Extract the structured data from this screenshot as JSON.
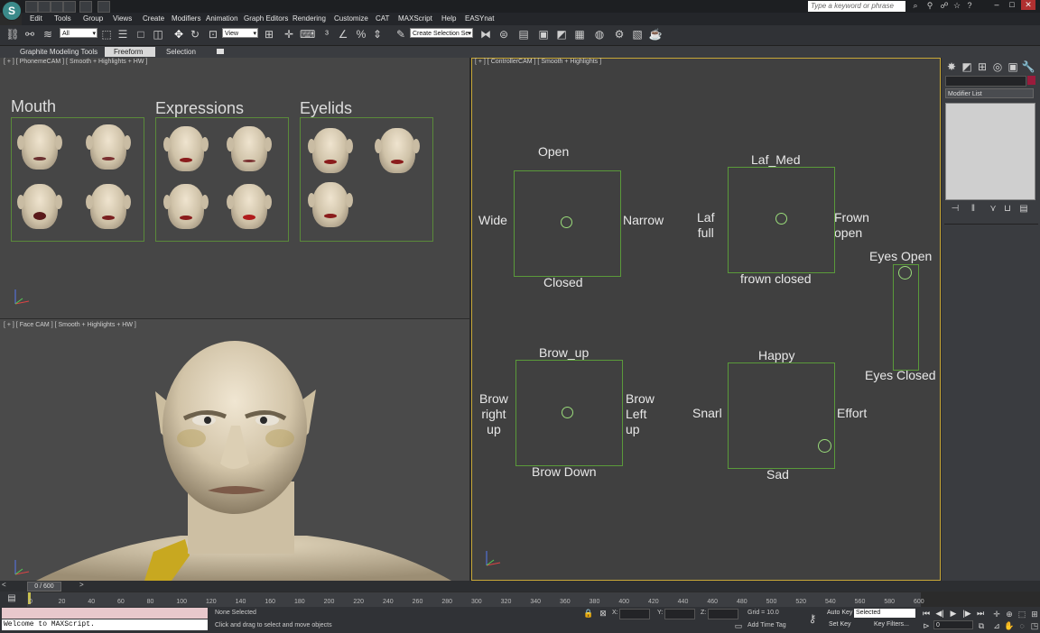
{
  "titlebar": {
    "search_placeholder": "Type a keyword or phrase",
    "logo_glyph": "S"
  },
  "menubar": {
    "items": [
      "Edit",
      "Tools",
      "Group",
      "Views",
      "Create",
      "Modifiers",
      "Animation",
      "Graph Editors",
      "Rendering",
      "Customize",
      "CAT",
      "MAXScript",
      "Help",
      "EASYnat"
    ]
  },
  "toolbar": {
    "selection_filter": "All",
    "reference_coord": "View",
    "named_selection": "Create Selection Se"
  },
  "ribbon": {
    "title": "Graphite Modeling Tools",
    "tabs": [
      "Freeform",
      "Selection"
    ]
  },
  "viewport_top_left": {
    "label": "[ + ] [ PhonemeCAM ] [ Smooth + Highlights + HW ]",
    "sections": [
      {
        "title": "Mouth"
      },
      {
        "title": "Expressions"
      },
      {
        "title": "Eyelids"
      }
    ]
  },
  "viewport_bottom_left": {
    "label": "[ + ] [ Face CAM ] [ Smooth + Highlights + HW ]"
  },
  "viewport_right": {
    "label": "[ + ] [ ControllerCAM ] [ Smooth + Highlights ]",
    "controls": {
      "mouth": {
        "top": "Open",
        "left": "Wide",
        "right": "Narrow",
        "bottom": "Closed"
      },
      "laf": {
        "top": "Laf_Med",
        "left": "Laf\nfull",
        "right": "Frown\nopen",
        "bottom": "frown closed"
      },
      "eyes": {
        "top": "Eyes Open",
        "bottom": "Eyes Closed"
      },
      "brow": {
        "top": "Brow_up",
        "left": "Brow\nright\nup",
        "right": "Brow\nLeft\nup",
        "bottom": "Brow Down"
      },
      "emotion": {
        "top": "Happy",
        "left": "Snarl",
        "right": "Effort",
        "bottom": "Sad"
      }
    }
  },
  "command_panel": {
    "modifier_list": "Modifier List",
    "color_swatch": "#9a1c3c"
  },
  "timeline": {
    "slider_label": "0 / 600",
    "ticks": [
      "0",
      "20",
      "40",
      "60",
      "80",
      "100",
      "120",
      "140",
      "160",
      "180",
      "200",
      "220",
      "240",
      "260",
      "280",
      "300",
      "320",
      "340",
      "360",
      "380",
      "400",
      "420",
      "440",
      "460",
      "480",
      "500",
      "520",
      "540",
      "560",
      "580",
      "600"
    ]
  },
  "statusbar": {
    "listener_output": "Welcome to MAXScript.",
    "selection_status": "None Selected",
    "prompt": "Click and drag to select and move objects",
    "x_label": "X:",
    "y_label": "Y:",
    "z_label": "Z:",
    "grid": "Grid = 10.0",
    "add_time_tag": "Add Time Tag",
    "auto_key": "Auto Key",
    "set_key": "Set Key",
    "key_mode": "Selected",
    "key_filters": "Key Filters...",
    "current_frame": "0"
  }
}
